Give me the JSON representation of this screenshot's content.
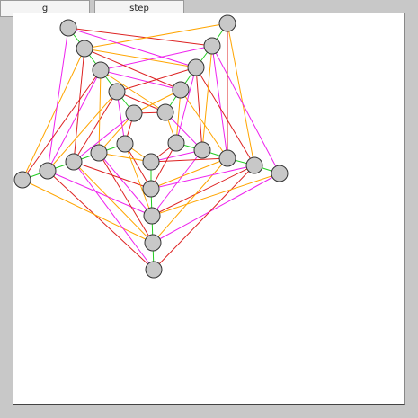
{
  "toolbar": {
    "g_label": "g",
    "step_label": "step"
  },
  "graph": {
    "edge_colors": {
      "green": "#22cc22",
      "red": "#dd2222",
      "orange": "#ffa500",
      "magenta": "#ee22ee"
    },
    "node_fill": "#c8c8c8",
    "node_stroke": "#333333",
    "node_count": 30
  }
}
